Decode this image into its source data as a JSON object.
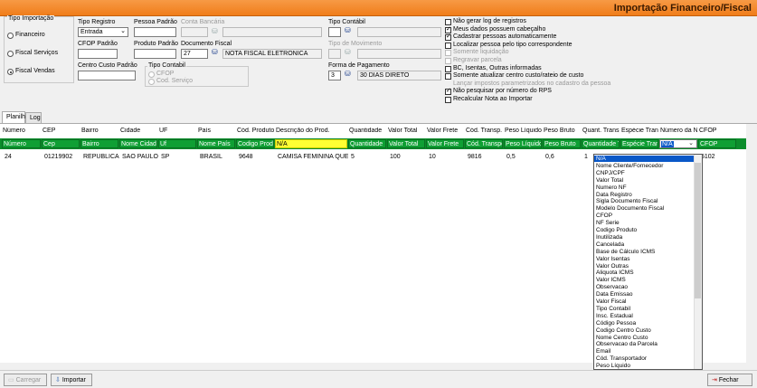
{
  "window": {
    "title": "Importação Financeiro/Fiscal"
  },
  "tipo_importacao": {
    "label": "Tipo Importação",
    "options": [
      "Financeiro",
      "Fiscal Serviços",
      "Fiscal Vendas"
    ],
    "selected": "Fiscal Vendas"
  },
  "fields": {
    "tipo_registro": {
      "label": "Tipo Registro",
      "value": "Entrada"
    },
    "pessoa_padrao": {
      "label": "Pessoa Padrão",
      "value": ""
    },
    "conta_bancaria": {
      "label": "Conta Bancária",
      "value": ""
    },
    "tipo_contabil_top": {
      "label": "Tipo Contábil",
      "value": ""
    },
    "cfop_padrao": {
      "label": "CFOP Padrão",
      "value": ""
    },
    "produto_padrao": {
      "label": "Produto Padrão",
      "value": ""
    },
    "documento_fiscal": {
      "label": "Documento Fiscal",
      "code": "27",
      "desc": "NOTA FISCAL ELETRONICA"
    },
    "tipo_movimento": {
      "label": "Tipo de Movimento",
      "value": ""
    },
    "centro_custo": {
      "label": "Centro Custo Padrão",
      "value": ""
    },
    "forma_pagamento": {
      "label": "Forma de Pagamento",
      "code": "3",
      "desc": "30 DIAS DIRETO"
    }
  },
  "tipo_contabil_group": {
    "label": "Tipo Contabil",
    "options": [
      "CFOP",
      "Cod. Serviço"
    ]
  },
  "options": [
    {
      "label": "Não gerar log de registros",
      "checked": false,
      "disabled": false
    },
    {
      "label": "Meus dados possuem cabeçalho",
      "checked": true,
      "disabled": false
    },
    {
      "label": "Cadastrar pessoas automaticamente",
      "checked": true,
      "disabled": false
    },
    {
      "label": "Localizar pessoa pelo tipo correspondente",
      "checked": false,
      "disabled": false
    },
    {
      "label": "Somente liquidação",
      "checked": false,
      "disabled": true
    },
    {
      "label": "Regravar parcela",
      "checked": false,
      "disabled": true
    },
    {
      "label": "BC, Isentas, Outras informadas",
      "checked": false,
      "disabled": false
    },
    {
      "label": "Somente atualizar centro custo/rateio de custo",
      "checked": false,
      "disabled": false
    },
    {
      "label": "Lançar impostos parametrizados no cadastro da pessoa",
      "checked": false,
      "disabled": true,
      "nobox": true
    },
    {
      "label": "Não pesquisar por número do RPS",
      "checked": true,
      "disabled": false
    },
    {
      "label": "Recalcular Nota ao Importar",
      "checked": false,
      "disabled": false
    }
  ],
  "tabs": [
    "Planilha",
    "Log"
  ],
  "grid": {
    "columns": [
      {
        "header": "Número",
        "map": "Número",
        "data": "24"
      },
      {
        "header": "CEP",
        "map": "Cep",
        "data": "01219902"
      },
      {
        "header": "Bairro",
        "map": "Bairro",
        "data": "REPUBLICA"
      },
      {
        "header": "Cidade",
        "map": "Nome Cidade",
        "data": "SAO PAULO"
      },
      {
        "header": "UF",
        "map": "Uf",
        "data": "SP"
      },
      {
        "header": "País",
        "map": "Nome País",
        "data": "BRASIL"
      },
      {
        "header": "Cód. Produto",
        "map": "Codigo Produto",
        "data": "9648"
      },
      {
        "header": "Descrição do Prod.",
        "map": "N/A",
        "data": "CAMISA FEMININA QUEENIE"
      },
      {
        "header": "Quantidade",
        "map": "Quantidade",
        "data": "5"
      },
      {
        "header": "Valor Total",
        "map": "Valor Total",
        "data": "100"
      },
      {
        "header": "Valor Frete",
        "map": "Valor Frete",
        "data": "10"
      },
      {
        "header": "Cód. Transp.",
        "map": "Cód. Transportador",
        "data": "9816"
      },
      {
        "header": "Peso Líquido",
        "map": "Peso Líquido",
        "data": "0,5"
      },
      {
        "header": "Peso Bruto",
        "map": "Peso Bruto",
        "data": "0,6"
      },
      {
        "header": "Quant. Transp.",
        "map": "Quantidade Transp.",
        "data": "1"
      },
      {
        "header": "Espécie Transp.",
        "map": "Espécie Transp.",
        "data": ""
      },
      {
        "header": "Número da NF",
        "map": "N/A",
        "data": ""
      },
      {
        "header": "CFOP",
        "map": "CFOP",
        "data": "5102"
      }
    ]
  },
  "dropdown_items": [
    "N/A",
    "Nome Cliente/Fornecedor",
    "CNPJ/CPF",
    "Valor Total",
    "Numero NF",
    "Data Registro",
    "Sigla Documento Fiscal",
    "Modelo Documento Fiscal",
    "CFOP",
    "NF Serie",
    "Codigo Produto",
    "Inutilizada",
    "Cancelada",
    "Base de Cálculo ICMS",
    "Valor Isentas",
    "Valor Outras",
    "Aliquota ICMS",
    "Valor ICMS",
    "Observacao",
    "Data Emissao",
    "Valor Fiscal",
    "Tipo Contabil",
    "Insc. Estadual",
    "Código Pessoa",
    "Codigo Centro Custo",
    "Nome Centro Custo",
    "Observacao da Parcela",
    "Email",
    "Cód. Transportador",
    "Peso Líquido"
  ],
  "buttons": {
    "carregar": "Carregar",
    "importar": "Importar",
    "fechar": "Fechar"
  }
}
